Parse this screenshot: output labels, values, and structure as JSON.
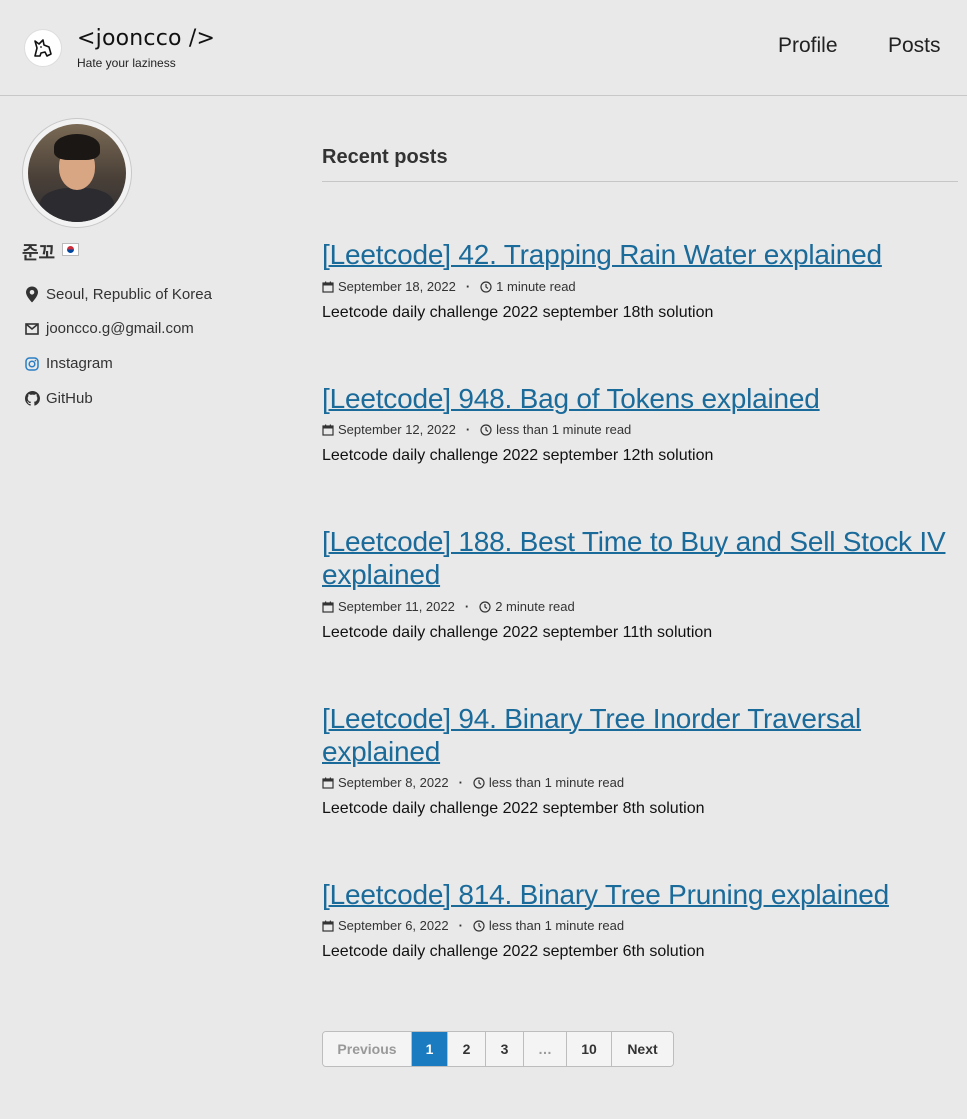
{
  "masthead": {
    "title": "<jooncco />",
    "subtitle": "Hate your laziness",
    "nav": [
      {
        "label": "Profile"
      },
      {
        "label": "Posts"
      }
    ]
  },
  "author": {
    "name": "준꼬",
    "location": "Seoul, Republic of Korea",
    "email": "jooncco.g@gmail.com",
    "instagram": "Instagram",
    "github": "GitHub"
  },
  "main": {
    "section_title": "Recent posts",
    "posts": [
      {
        "title": "[Leetcode] 42. Trapping Rain Water explained",
        "date": "September 18, 2022",
        "read_time": "1 minute read",
        "excerpt": "Leetcode daily challenge 2022 september 18th solution"
      },
      {
        "title": "[Leetcode] 948. Bag of Tokens explained",
        "date": "September 12, 2022",
        "read_time": "less than 1 minute read",
        "excerpt": "Leetcode daily challenge 2022 september 12th solution"
      },
      {
        "title": "[Leetcode] 188. Best Time to Buy and Sell Stock IV explained",
        "date": "September 11, 2022",
        "read_time": "2 minute read",
        "excerpt": "Leetcode daily challenge 2022 september 11th solution"
      },
      {
        "title": "[Leetcode] 94. Binary Tree Inorder Traversal explained",
        "date": "September 8, 2022",
        "read_time": "less than 1 minute read",
        "excerpt": "Leetcode daily challenge 2022 september 8th solution"
      },
      {
        "title": "[Leetcode] 814. Binary Tree Pruning explained",
        "date": "September 6, 2022",
        "read_time": "less than 1 minute read",
        "excerpt": "Leetcode daily challenge 2022 september 6th solution"
      }
    ]
  },
  "pagination": {
    "previous": "Previous",
    "pages": [
      "1",
      "2",
      "3",
      "…",
      "10"
    ],
    "current": "1",
    "next": "Next"
  },
  "colors": {
    "link": "#1a6a9a",
    "current_page": "#1a7bc0",
    "background": "#e9e9e9"
  }
}
